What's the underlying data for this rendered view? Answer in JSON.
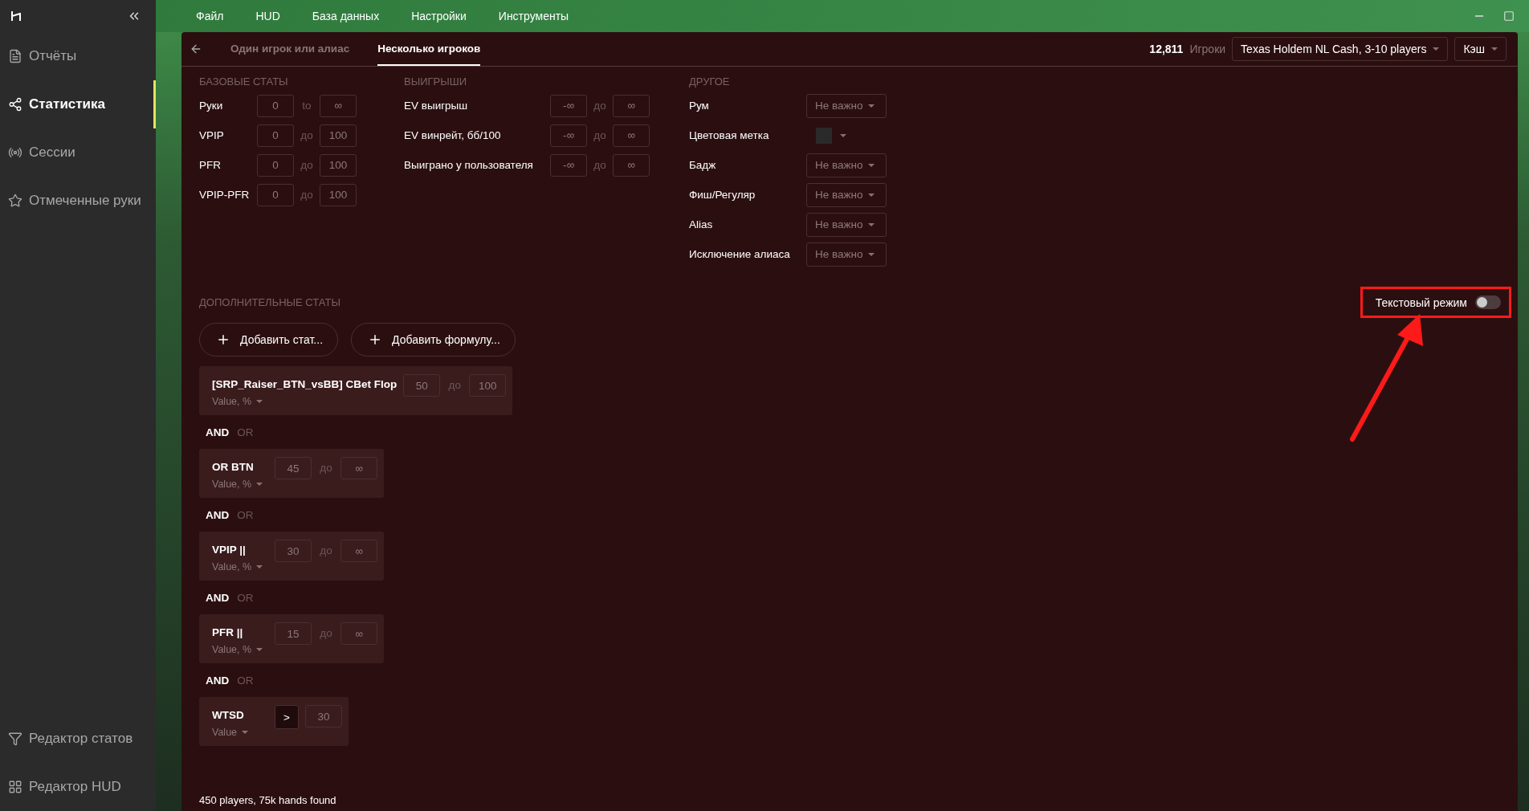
{
  "menu": [
    "Файл",
    "HUD",
    "База данных",
    "Настройки",
    "Инструменты"
  ],
  "sidebar": {
    "items": [
      {
        "label": "Отчёты",
        "selected": false
      },
      {
        "label": "Статистика",
        "selected": true
      },
      {
        "label": "Сессии",
        "selected": false
      },
      {
        "label": "Отмеченные руки",
        "selected": false
      }
    ],
    "bottom_items": [
      {
        "label": "Редактор статов",
        "selected": false
      },
      {
        "label": "Редактор HUD",
        "selected": false
      }
    ]
  },
  "tabs": [
    {
      "label": "Один игрок или алиас",
      "selected": false
    },
    {
      "label": "Несколько игроков",
      "selected": true
    }
  ],
  "header": {
    "count": "12,811",
    "count_label": "Игроки",
    "game": "Texas Holdem NL Cash, 3-10 players",
    "type": "Кэш"
  },
  "base_stats": {
    "title": "БАЗОВЫЕ СТАТЫ",
    "rows": [
      {
        "label": "Руки",
        "from": "0",
        "sep": "to",
        "to": "∞"
      },
      {
        "label": "VPIP",
        "from": "0",
        "sep": "до",
        "to": "100"
      },
      {
        "label": "PFR",
        "from": "0",
        "sep": "до",
        "to": "100"
      },
      {
        "label": "VPIP-PFR",
        "from": "0",
        "sep": "до",
        "to": "100"
      }
    ]
  },
  "winnings": {
    "title": "ВЫИГРЫШИ",
    "rows": [
      {
        "label": "EV выигрыш",
        "from": "-∞",
        "sep": "до",
        "to": "∞"
      },
      {
        "label": "EV винрейт, бб/100",
        "from": "-∞",
        "sep": "до",
        "to": "∞"
      },
      {
        "label": "Выиграно у пользователя",
        "from": "-∞",
        "sep": "до",
        "to": "∞"
      }
    ]
  },
  "other": {
    "title": "ДРУГОЕ",
    "rows": [
      {
        "label": "Рум",
        "kind": "dropdown",
        "value": "Не важно"
      },
      {
        "label": "Цветовая метка",
        "kind": "color",
        "color": "#2a2a2a"
      },
      {
        "label": "Бадж",
        "kind": "dropdown",
        "value": "Не важно"
      },
      {
        "label": "Фиш/Регуляр",
        "kind": "dropdown",
        "value": "Не важно"
      },
      {
        "label": "Alias",
        "kind": "dropdown",
        "value": "Не важно"
      },
      {
        "label": "Исключение алиаса",
        "kind": "dropdown",
        "value": "Не важно"
      }
    ]
  },
  "text_mode": {
    "label": "Текстовый режим",
    "on": false
  },
  "additional": {
    "title": "ДОПОЛНИТЕЛЬНЫЕ СТАТЫ",
    "buttons": [
      "Добавить стат...",
      "Добавить формулу..."
    ],
    "filters": [
      {
        "kind": "range",
        "name": "[SRP_Raiser_BTN_vsBB] CBet Flop",
        "metric": "Value, %",
        "from": "50",
        "sep": "до",
        "to": "100"
      },
      {
        "kind": "range",
        "name": "OR BTN",
        "metric": "Value, %",
        "from": "45",
        "sep": "до",
        "to": "∞",
        "joiner": [
          {
            "label": "AND",
            "selected": true
          },
          {
            "label": "OR",
            "selected": false
          }
        ]
      },
      {
        "kind": "range",
        "name": "VPIP ||",
        "metric": "Value, %",
        "from": "30",
        "sep": "до",
        "to": "∞",
        "joiner": [
          {
            "label": "AND",
            "selected": true
          },
          {
            "label": "OR",
            "selected": false
          }
        ]
      },
      {
        "kind": "range",
        "name": "PFR ||",
        "metric": "Value, %",
        "from": "15",
        "sep": "до",
        "to": "∞",
        "joiner": [
          {
            "label": "AND",
            "selected": true
          },
          {
            "label": "OR",
            "selected": false
          }
        ]
      },
      {
        "kind": "compare",
        "name": "WTSD",
        "metric": "Value",
        "op": ">",
        "value": "30",
        "joiner": [
          {
            "label": "AND",
            "selected": true
          },
          {
            "label": "OR",
            "selected": false
          }
        ]
      }
    ]
  },
  "status": "450 players, 75k hands found"
}
